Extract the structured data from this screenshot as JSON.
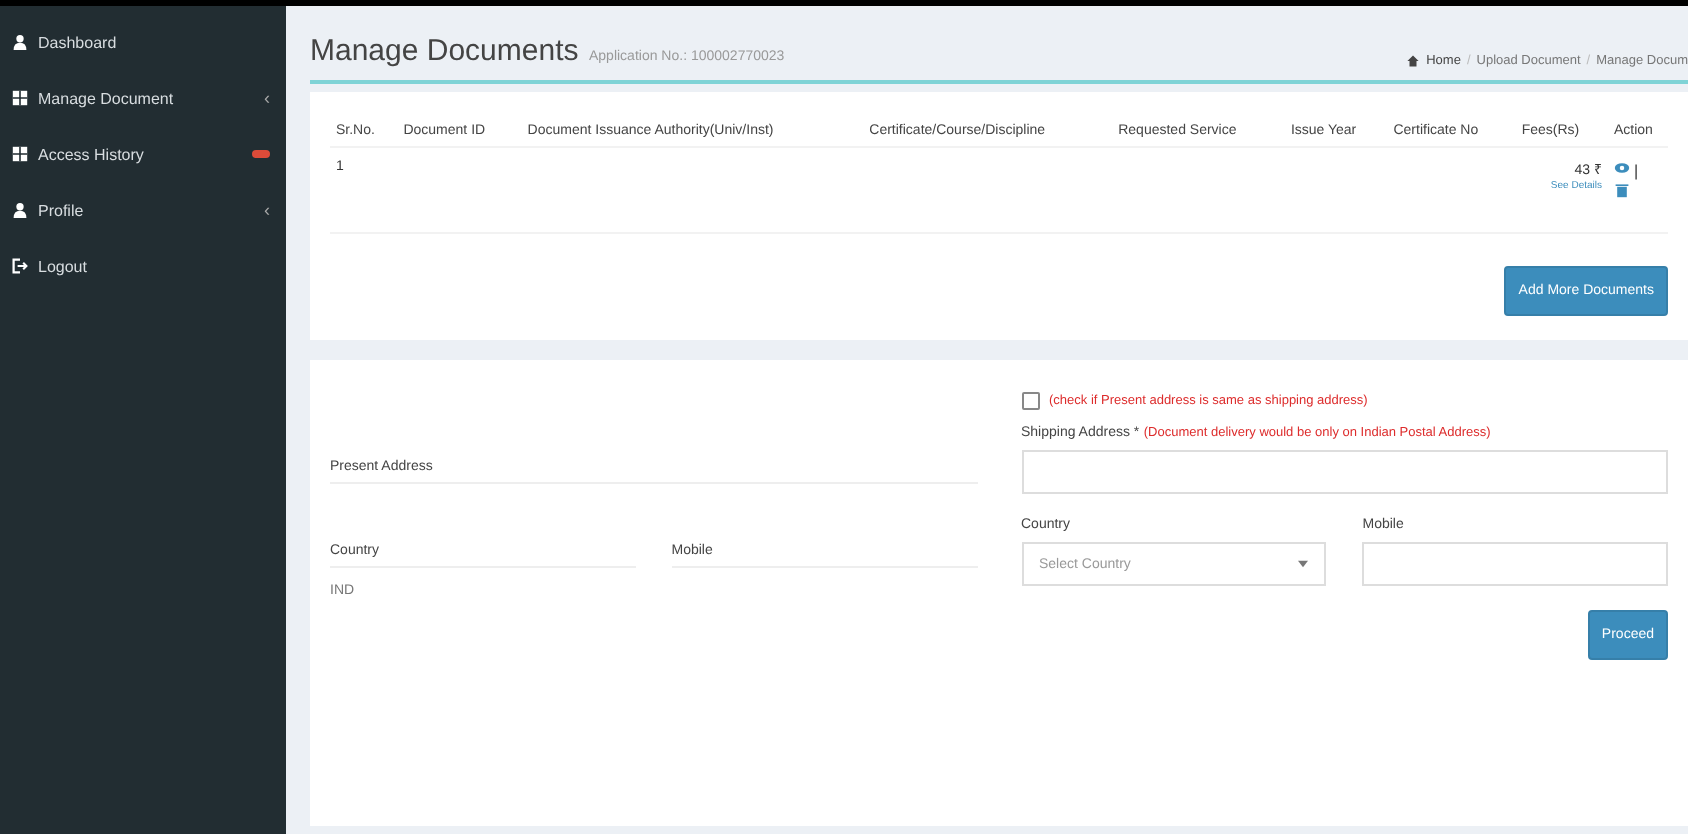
{
  "sidebar": {
    "items": [
      {
        "label": "Dashboard",
        "kind": "user",
        "chevron": false,
        "badge": false
      },
      {
        "label": "Manage Document",
        "kind": "grid",
        "chevron": true,
        "badge": false
      },
      {
        "label": "Access History",
        "kind": "grid",
        "chevron": false,
        "badge": true
      },
      {
        "label": "Profile",
        "kind": "user",
        "chevron": true,
        "badge": false
      },
      {
        "label": "Logout",
        "kind": "logout",
        "chevron": false,
        "badge": false
      }
    ],
    "chevron": "‹"
  },
  "header": {
    "title": "Manage Documents",
    "subtitle": "Application No.: 100002770023",
    "breadcrumb": [
      "Home",
      "Upload Document",
      "Manage Docum"
    ],
    "breadcrumb_separator": "/"
  },
  "table": {
    "columns": [
      "Sr.No.",
      "Document ID",
      "Document Issuance Authority(Univ/Inst)",
      "Certificate/Course/Discipline",
      "Requested Service",
      "Issue Year",
      "Certificate No",
      "Fees(Rs)",
      "Action"
    ],
    "rows": [
      {
        "sr_no": "1",
        "fees": "43 ₹",
        "details_link": "See Details",
        "separator": "|"
      }
    ]
  },
  "add_button": "Add More Documents",
  "address": {
    "present_label": "Present Address",
    "country_label": "Country",
    "country_value": "IND",
    "mobile_label": "Mobile"
  },
  "shipping": {
    "same_checkbox": {
      "label": "(check if Present address is same as shipping address)",
      "checked": false
    },
    "label": "Shipping Address *",
    "note": "(Document delivery would be only on Indian Postal Address)",
    "country_label": "Country",
    "country_placeholder": "Select Country",
    "mobile_label": "Mobile"
  },
  "proceed_button": "Proceed"
}
